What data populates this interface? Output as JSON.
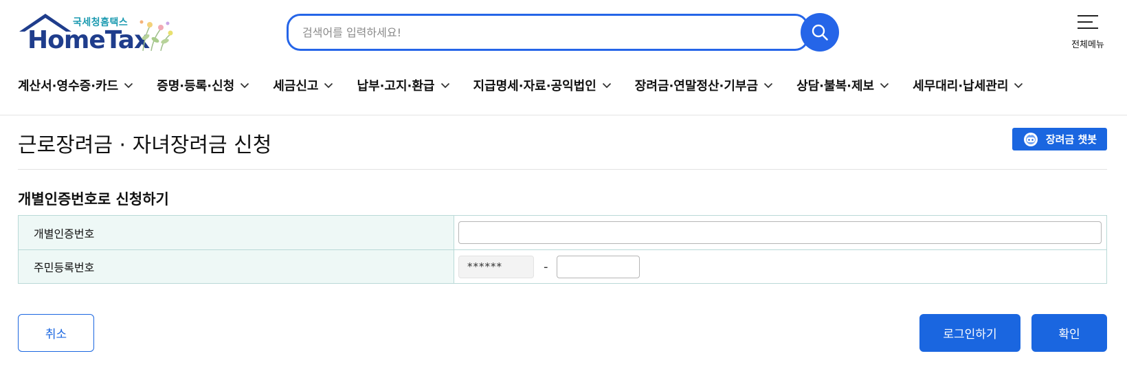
{
  "header": {
    "logo": {
      "kr_text": "국세청홈택스",
      "en_text": "HomeTax"
    },
    "search": {
      "placeholder": "검색어를 입력하세요!"
    },
    "all_menu_label": "전체메뉴"
  },
  "gnb": {
    "items": [
      {
        "label": "계산서·영수증·카드"
      },
      {
        "label": "증명·등록·신청"
      },
      {
        "label": "세금신고"
      },
      {
        "label": "납부·고지·환급"
      },
      {
        "label": "지급명세·자료·공익법인"
      },
      {
        "label": "장려금·연말정산·기부금"
      },
      {
        "label": "상담·불복·제보"
      },
      {
        "label": "세무대리·납세관리"
      }
    ]
  },
  "page": {
    "title": "근로장려금 · 자녀장려금 신청",
    "chatbot_label": "장려금 챗봇",
    "section_title": "개별인증번호로 신청하기"
  },
  "form": {
    "rows": [
      {
        "label": "개별인증번호",
        "value": ""
      },
      {
        "label": "주민등록번호",
        "masked_front": "******",
        "separator": "-",
        "back_value": ""
      }
    ]
  },
  "buttons": {
    "cancel": "취소",
    "login": "로그인하기",
    "confirm": "확인"
  },
  "colors": {
    "brand_blue": "#1a66e0",
    "logo_navy": "#1f3d8c",
    "logo_teal": "#1b9ab0",
    "table_border": "#b9d9d7",
    "label_bg": "#eef8f6"
  }
}
